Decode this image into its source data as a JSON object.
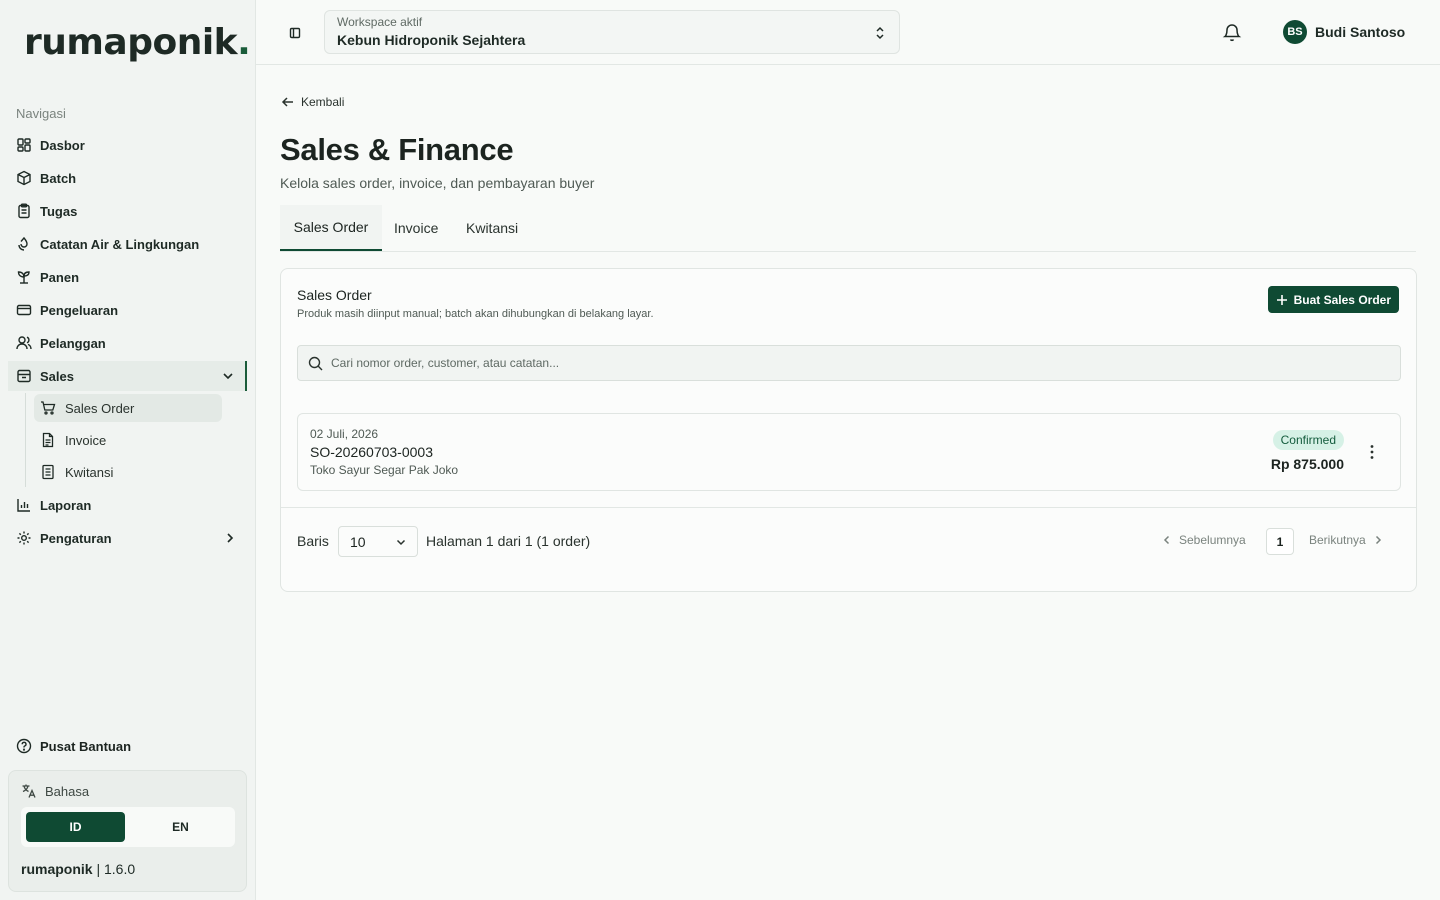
{
  "brand": {
    "name": "rumaponik",
    "dot": "."
  },
  "sidebar": {
    "heading": "Navigasi",
    "items": [
      {
        "label": "Dasbor",
        "icon": "dashboard-icon"
      },
      {
        "label": "Batch",
        "icon": "box-icon"
      },
      {
        "label": "Tugas",
        "icon": "clipboard-icon"
      },
      {
        "label": "Catatan Air & Lingkungan",
        "icon": "droplet-icon"
      },
      {
        "label": "Panen",
        "icon": "sprout-icon"
      },
      {
        "label": "Pengeluaran",
        "icon": "credit-card-icon"
      },
      {
        "label": "Pelanggan",
        "icon": "users-icon"
      },
      {
        "label": "Sales",
        "icon": "archive-icon"
      },
      {
        "label": "Laporan",
        "icon": "bar-chart-icon"
      },
      {
        "label": "Pengaturan",
        "icon": "gear-icon"
      }
    ],
    "sales_sub": [
      {
        "label": "Sales Order",
        "icon": "cart-icon"
      },
      {
        "label": "Invoice",
        "icon": "file-icon"
      },
      {
        "label": "Kwitansi",
        "icon": "receipt-icon"
      }
    ],
    "help": "Pusat Bantuan",
    "language": {
      "title": "Bahasa",
      "options": [
        "ID",
        "EN"
      ],
      "selected": "ID"
    },
    "version": {
      "name": "rumaponik",
      "sep": "|",
      "number": "1.6.0"
    }
  },
  "topbar": {
    "workspace_label": "Workspace aktif",
    "workspace_value": "Kebun Hidroponik Sejahtera",
    "user_initials": "BS",
    "user_name": "Budi Santoso"
  },
  "main": {
    "back": "Kembali",
    "title": "Sales & Finance",
    "subtitle": "Kelola sales order, invoice, dan pembayaran buyer",
    "tabs": [
      "Sales Order",
      "Invoice",
      "Kwitansi"
    ],
    "active_tab": "Sales Order",
    "card": {
      "title": "Sales Order",
      "subtitle": "Produk masih diinput manual; batch akan dihubungkan di belakang layar.",
      "create_button": "Buat Sales Order",
      "search_placeholder": "Cari nomor order, customer, atau catatan...",
      "orders": [
        {
          "date": "02 Juli, 2026",
          "number": "SO-20260703-0003",
          "customer": "Toko Sayur Segar Pak Joko",
          "status": "Confirmed",
          "amount": "Rp 875.000"
        }
      ],
      "pagination": {
        "rows_label": "Baris",
        "rows_value": "10",
        "page_info": "Halaman 1 dari 1 (1 order)",
        "prev": "Sebelumnya",
        "current_page": "1",
        "next": "Berikutnya"
      }
    }
  },
  "colors": {
    "brand": "#0f4a33",
    "status_confirmed_bg": "#d6f1e6",
    "status_confirmed_text": "#145c3d"
  }
}
